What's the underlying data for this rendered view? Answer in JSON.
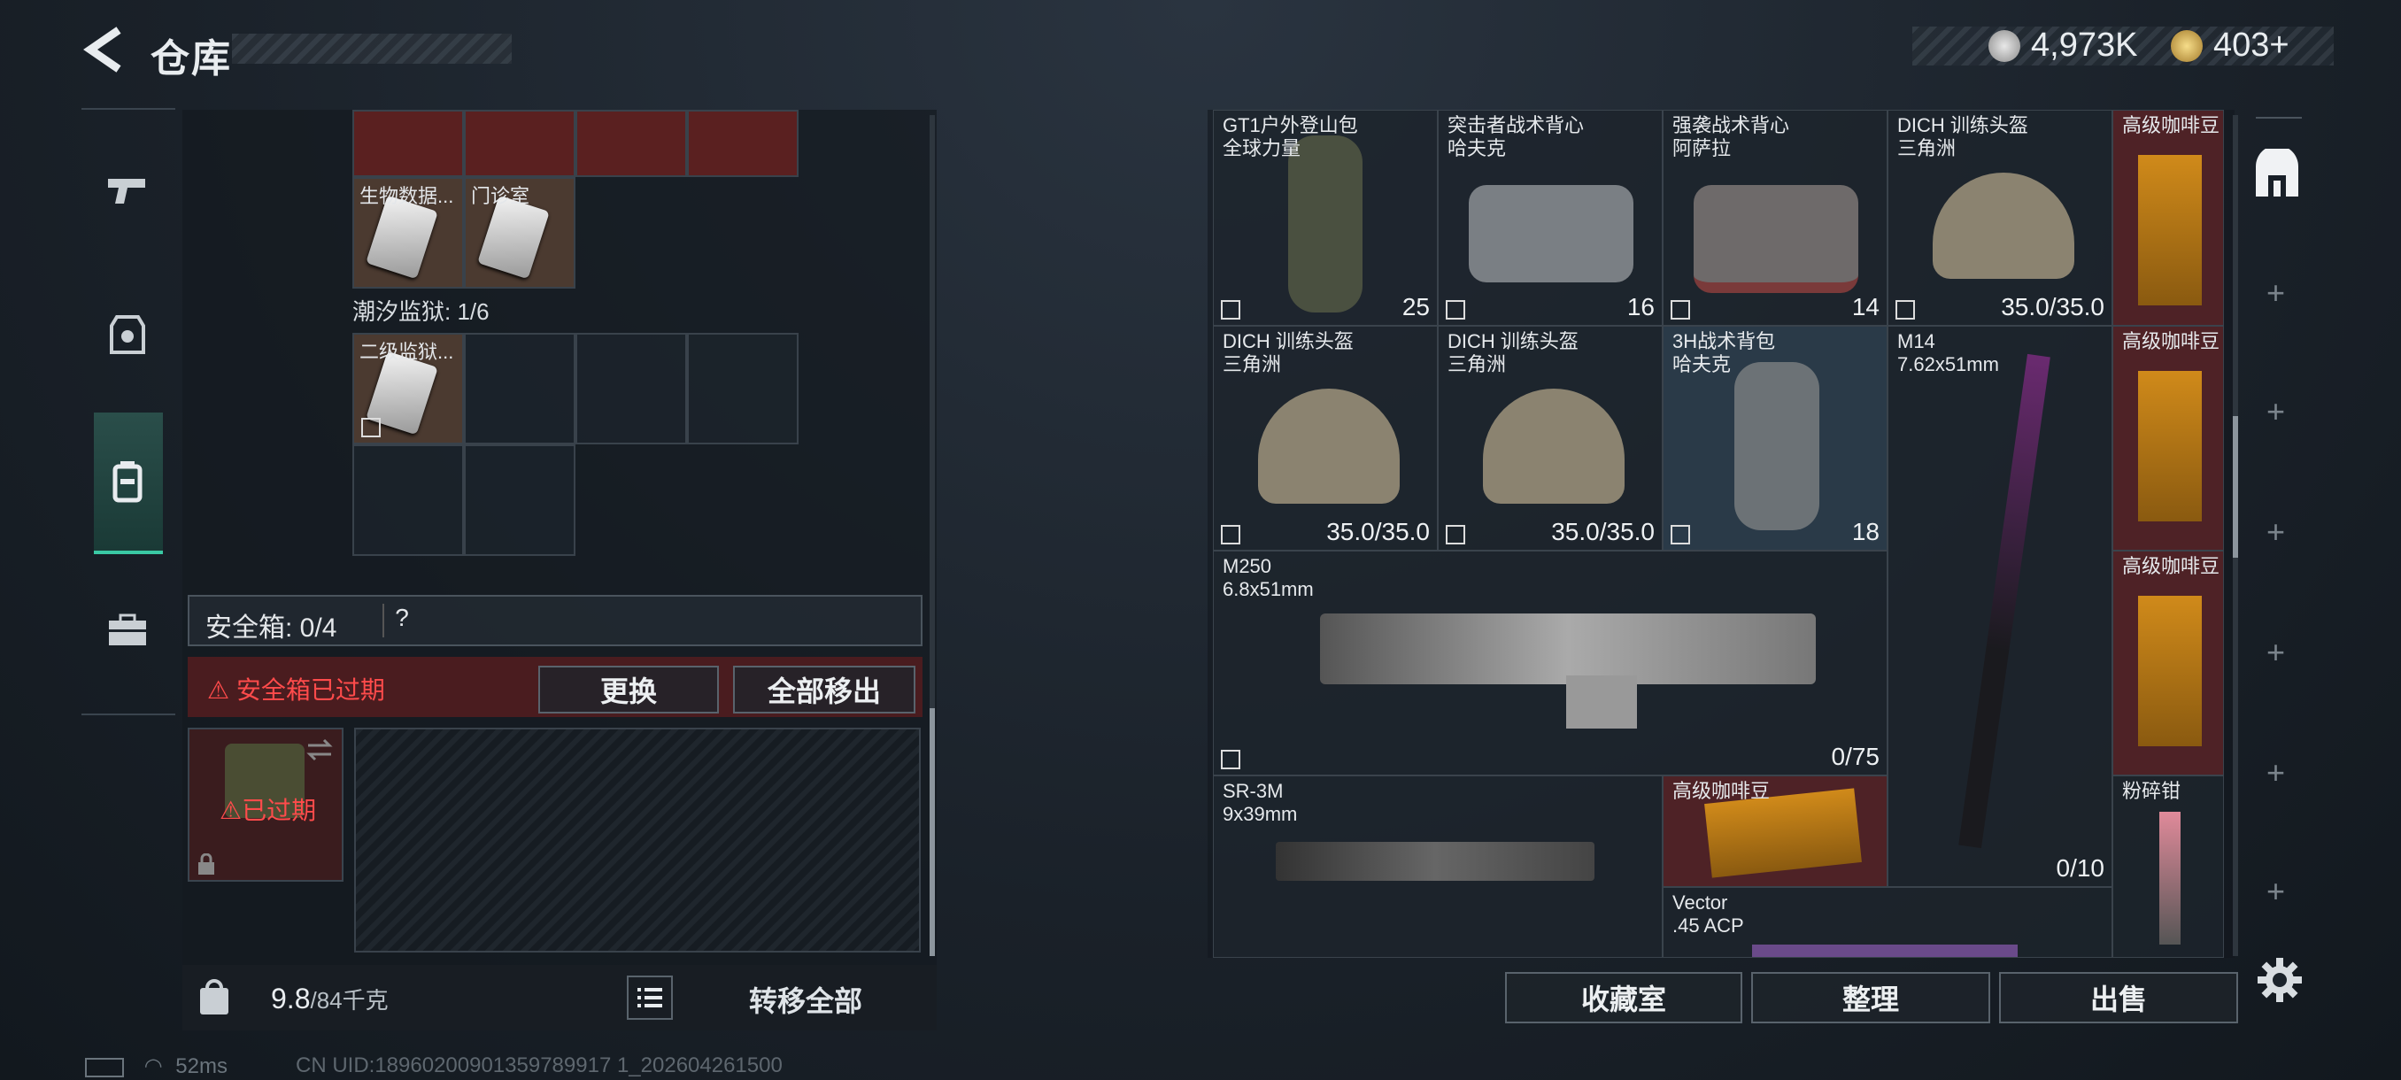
{
  "header": {
    "title": "仓库",
    "currency_silver": "4,973K",
    "currency_gold": "403+"
  },
  "left_grid": {
    "items": [
      {
        "label": "生物数据..."
      },
      {
        "label": "门诊室"
      },
      {
        "label": "二级监狱..."
      }
    ],
    "section_label": "潮汐监狱: 1/6"
  },
  "safe": {
    "label": "安全箱: 0/4",
    "help": "?",
    "expired_message": "安全箱已过期",
    "replace_button": "更换",
    "move_out_button": "全部移出",
    "expired_tag": "已过期"
  },
  "left_bottom": {
    "weight": "9.8",
    "weight_max": "/84千克",
    "transfer_all": "转移全部"
  },
  "status": {
    "ping": "52ms",
    "uid": "CN UID:18960200901359789917 1_202604261500"
  },
  "right_grid": {
    "items": [
      {
        "name1": "GT1户外登山包",
        "name2": "全球力量",
        "value": "25"
      },
      {
        "name1": "突击者战术背心",
        "name2": "哈夫克",
        "value": "16"
      },
      {
        "name1": "强袭战术背心",
        "name2": "阿萨拉",
        "value": "14"
      },
      {
        "name1": "DICH 训练头盔",
        "name2": "三角洲",
        "value": "35.0/35.0"
      },
      {
        "name1": "高级咖啡豆",
        "name2": "",
        "value": ""
      },
      {
        "name1": "DICH 训练头盔",
        "name2": "三角洲",
        "value": "35.0/35.0"
      },
      {
        "name1": "DICH 训练头盔",
        "name2": "三角洲",
        "value": "35.0/35.0"
      },
      {
        "name1": "3H战术背包",
        "name2": "哈夫克",
        "value": "18"
      },
      {
        "name1": "M14",
        "name2": "7.62x51mm",
        "value": "0/10"
      },
      {
        "name1": "高级咖啡豆",
        "name2": "",
        "value": ""
      },
      {
        "name1": "M250",
        "name2": "6.8x51mm",
        "value": "0/75"
      },
      {
        "name1": "高级咖啡豆",
        "name2": "",
        "value": ""
      },
      {
        "name1": "SR-3M",
        "name2": "9x39mm",
        "value": ""
      },
      {
        "name1": "高级咖啡豆",
        "name2": "",
        "value": ""
      },
      {
        "name1": "粉碎钳",
        "name2": "",
        "value": ""
      },
      {
        "name1": "Vector",
        "name2": ".45 ACP",
        "value": ""
      }
    ]
  },
  "bottom_buttons": {
    "collection": "收藏室",
    "sort": "整理",
    "sell": "出售"
  }
}
